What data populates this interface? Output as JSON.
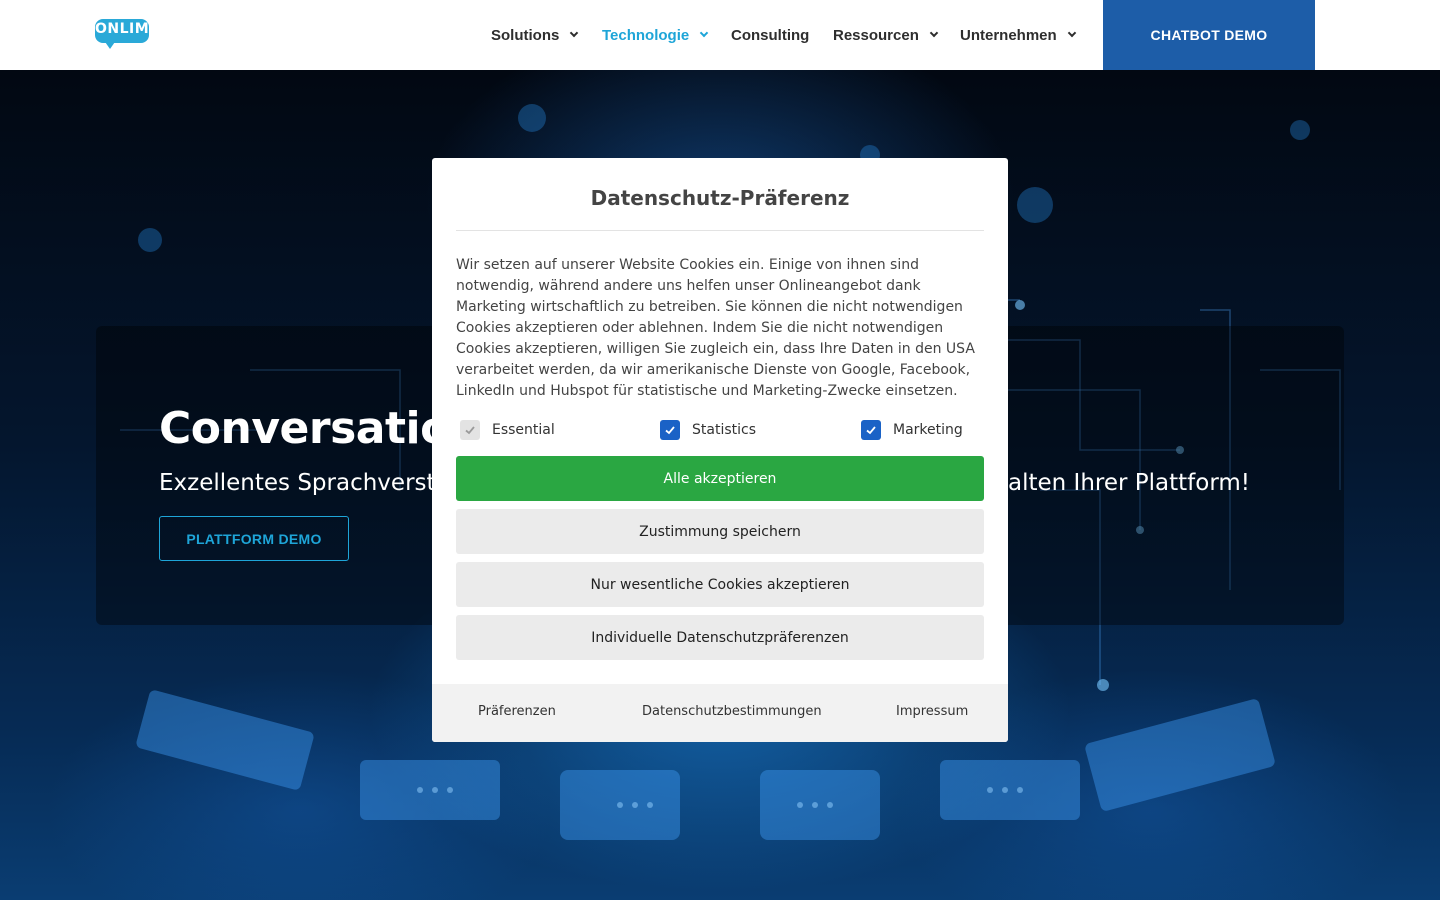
{
  "header": {
    "logo_text": "ONLIM",
    "nav": [
      {
        "label": "Solutions",
        "has_dropdown": true,
        "active": false
      },
      {
        "label": "Technologie",
        "has_dropdown": true,
        "active": true
      },
      {
        "label": "Consulting",
        "has_dropdown": false,
        "active": false
      },
      {
        "label": "Ressourcen",
        "has_dropdown": true,
        "active": false
      },
      {
        "label": "Unternehmen",
        "has_dropdown": true,
        "active": false
      }
    ],
    "cta_label": "CHATBOT DEMO"
  },
  "hero": {
    "title_visible": "Conversation",
    "subtitle_left_visible": "Exzellentes Sprachverstä",
    "subtitle_right_visible": "alten Ihrer Plattform!",
    "button_label": "PLATTFORM DEMO"
  },
  "modal": {
    "title": "Datenschutz-Präferenz",
    "body": "Wir setzen auf unserer Website Cookies ein. Einige von ihnen sind notwendig, während andere uns helfen unser Onlineangebot dank Marketing wirtschaftlich zu betreiben. Sie können die nicht notwendigen Cookies akzeptieren oder ablehnen. Indem Sie die nicht notwendigen Cookies akzeptieren, willigen Sie zugleich ein, dass Ihre Daten in den USA verarbeitet werden, da wir amerikanische Dienste von Google, Facebook, LinkedIn und Hubspot für statistische und Marketing-Zwecke einsetzen.",
    "checkboxes": [
      {
        "label": "Essential",
        "checked": true,
        "disabled": true
      },
      {
        "label": "Statistics",
        "checked": true,
        "disabled": false
      },
      {
        "label": "Marketing",
        "checked": true,
        "disabled": false
      }
    ],
    "buttons": {
      "accept_all": "Alle akzeptieren",
      "save": "Zustimmung speichern",
      "essential_only": "Nur wesentliche Cookies akzeptieren",
      "individual": "Individuelle Datenschutzpräferenzen"
    },
    "footer_links": [
      "Präferenzen",
      "Datenschutzbestimmungen",
      "Impressum"
    ]
  },
  "colors": {
    "brand": "#2aa9d8",
    "nav_active": "#1ea5d8",
    "cta_bg": "#1d5da8",
    "accept_green": "#2aa742",
    "checkbox_blue": "#1a62c6"
  }
}
